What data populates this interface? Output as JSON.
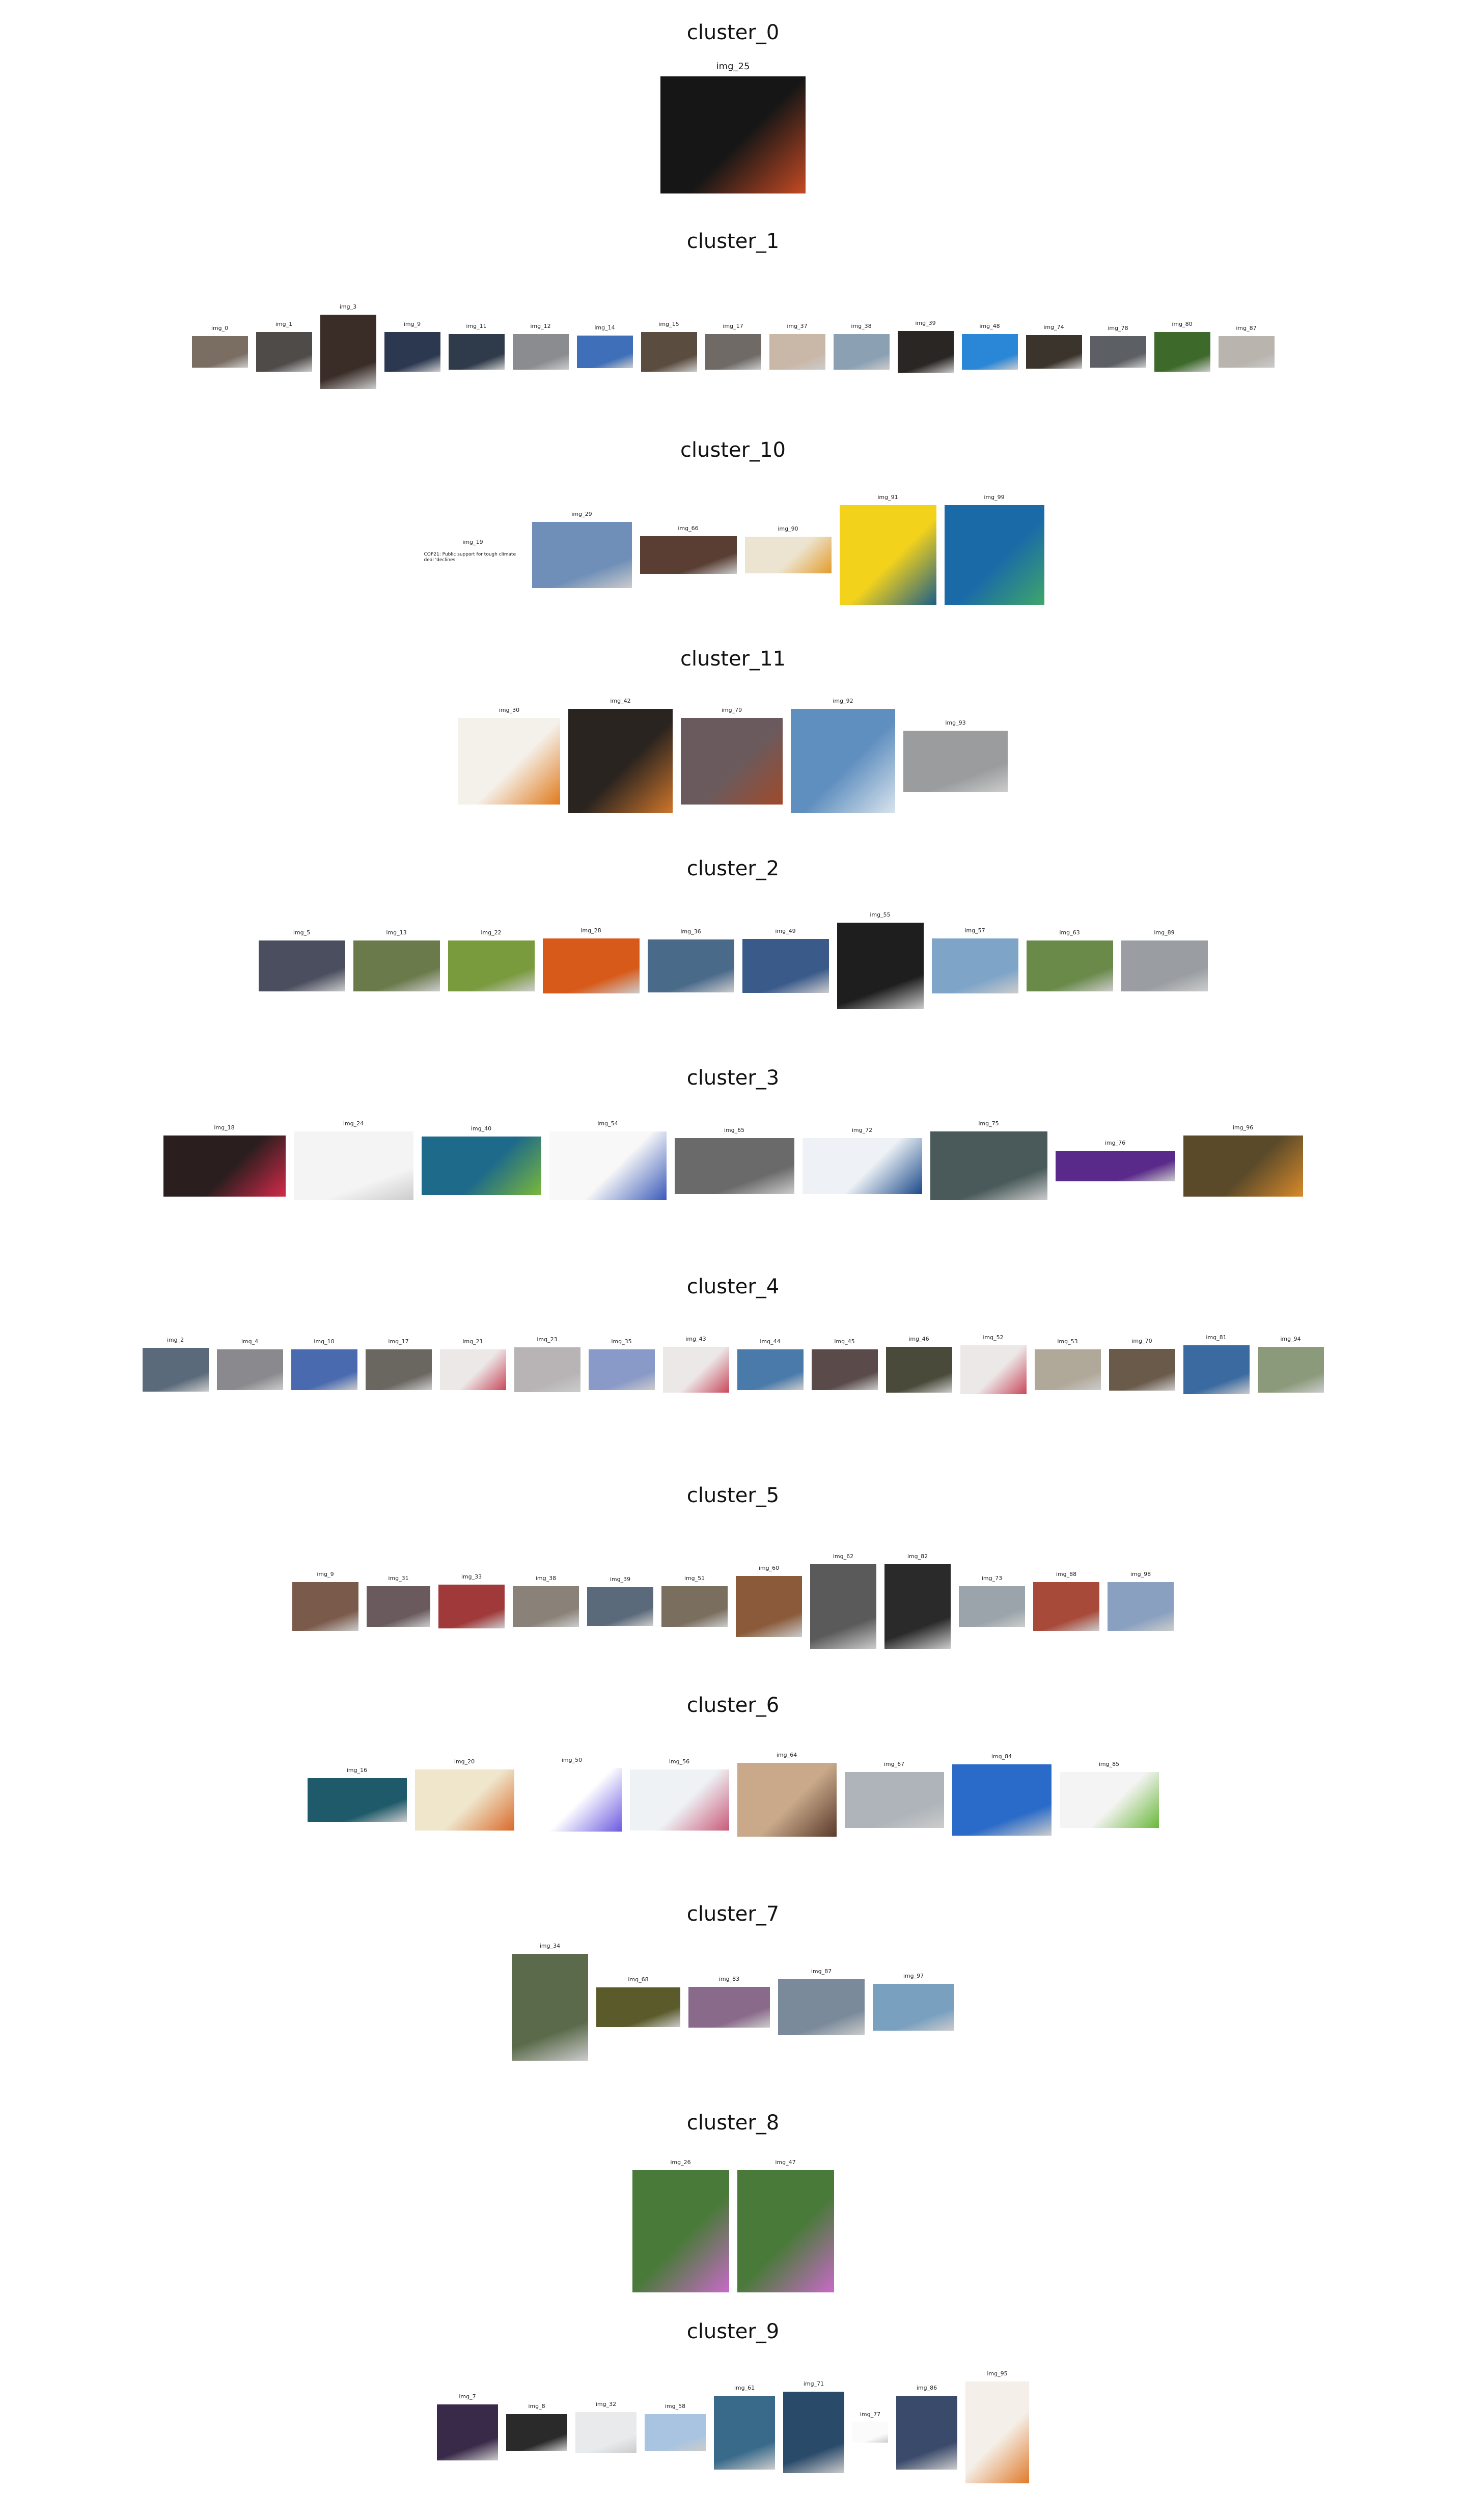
{
  "clusters": [
    {
      "title": "cluster_0",
      "images": [
        {
          "label": "img_25",
          "color": "#161616",
          "accent": "#c64a24"
        }
      ]
    },
    {
      "title": "cluster_1",
      "images": [
        {
          "label": "img_0",
          "color": "#7a6e62"
        },
        {
          "label": "img_1",
          "color": "#4e4b49"
        },
        {
          "label": "img_3",
          "color": "#3a2d28"
        },
        {
          "label": "img_9",
          "color": "#2b3850"
        },
        {
          "label": "img_11",
          "color": "#2f3a4a"
        },
        {
          "label": "img_12",
          "color": "#8a8c90"
        },
        {
          "label": "img_14",
          "color": "#3f6fb8"
        },
        {
          "label": "img_15",
          "color": "#5a4c3e"
        },
        {
          "label": "img_17",
          "color": "#6f6a66"
        },
        {
          "label": "img_37",
          "color": "#c9b8a8"
        },
        {
          "label": "img_38",
          "color": "#8ca0b4"
        },
        {
          "label": "img_39",
          "color": "#2a2624"
        },
        {
          "label": "img_48",
          "color": "#2a86d6"
        },
        {
          "label": "img_74",
          "color": "#3b342c"
        },
        {
          "label": "img_78",
          "color": "#5c6064"
        },
        {
          "label": "img_80",
          "color": "#3d6a2a"
        },
        {
          "label": "img_87",
          "color": "#b9b4ae"
        }
      ]
    },
    {
      "title": "cluster_10",
      "images": [
        {
          "label": "img_19",
          "color": "#ffffff",
          "text": "COP21: Public support for tough climate deal 'declines'"
        },
        {
          "label": "img_29",
          "color": "#6f8fb8"
        },
        {
          "label": "img_66",
          "color": "#5a3e34"
        },
        {
          "label": "img_90",
          "color": "#ece4d0",
          "accent": "#e39c2c"
        },
        {
          "label": "img_91",
          "color": "#f3d21c",
          "accent": "#1d5e86"
        },
        {
          "label": "img_99",
          "color": "#1a6aa8",
          "accent": "#3fa66a"
        }
      ]
    },
    {
      "title": "cluster_11",
      "images": [
        {
          "label": "img_30",
          "color": "#f4f0ea",
          "accent": "#e07a1a"
        },
        {
          "label": "img_42",
          "color": "#2a2420",
          "accent": "#d0762a"
        },
        {
          "label": "img_79",
          "color": "#6a5a5e",
          "accent": "#a04a2a"
        },
        {
          "label": "img_92",
          "color": "#5f8fbf",
          "accent": "#d9e4ee"
        },
        {
          "label": "img_93",
          "color": "#9a9c9e"
        }
      ]
    },
    {
      "title": "cluster_2",
      "images": [
        {
          "label": "img_5",
          "color": "#4a4e5e"
        },
        {
          "label": "img_13",
          "color": "#6a7a4a"
        },
        {
          "label": "img_22",
          "color": "#7a9a3e"
        },
        {
          "label": "img_28",
          "color": "#d85a1a"
        },
        {
          "label": "img_36",
          "color": "#4a6a8a"
        },
        {
          "label": "img_49",
          "color": "#3a5a8a"
        },
        {
          "label": "img_55",
          "color": "#1e1e1e"
        },
        {
          "label": "img_57",
          "color": "#7ea4c8"
        },
        {
          "label": "img_63",
          "color": "#6a8a4a"
        },
        {
          "label": "img_89",
          "color": "#9a9ea2"
        }
      ]
    },
    {
      "title": "cluster_3",
      "images": [
        {
          "label": "img_18",
          "color": "#2a1e1e",
          "accent": "#d42a4a"
        },
        {
          "label": "img_24",
          "color": "#f4f4f4"
        },
        {
          "label": "img_40",
          "color": "#1e6a8a",
          "accent": "#7ab83a"
        },
        {
          "label": "img_54",
          "color": "#f8f8f8",
          "accent": "#3a5ab8"
        },
        {
          "label": "img_65",
          "color": "#6a6a6a"
        },
        {
          "label": "img_72",
          "color": "#eef2f6",
          "accent": "#1a4a8a"
        },
        {
          "label": "img_75",
          "color": "#4a5a5a"
        },
        {
          "label": "img_76",
          "color": "#5a2a8a"
        },
        {
          "label": "img_96",
          "color": "#5a4a2a",
          "accent": "#d88a2a"
        }
      ]
    },
    {
      "title": "cluster_4",
      "images": [
        {
          "label": "img_2",
          "color": "#5a6a7a"
        },
        {
          "label": "img_4",
          "color": "#8a8a8e"
        },
        {
          "label": "img_10",
          "color": "#4a6ab0"
        },
        {
          "label": "img_17",
          "color": "#6a6660"
        },
        {
          "label": "img_21",
          "color": "#ece8e8",
          "accent": "#c8485a"
        },
        {
          "label": "img_23",
          "color": "#b8b4b6"
        },
        {
          "label": "img_35",
          "color": "#8a9ac8"
        },
        {
          "label": "img_43",
          "color": "#ece8e8",
          "accent": "#c8485a"
        },
        {
          "label": "img_44",
          "color": "#4a7aaa"
        },
        {
          "label": "img_45",
          "color": "#5a4a4a"
        },
        {
          "label": "img_46",
          "color": "#4a4a3a"
        },
        {
          "label": "img_52",
          "color": "#ece8e8",
          "accent": "#c8485a"
        },
        {
          "label": "img_53",
          "color": "#b0a898"
        },
        {
          "label": "img_70",
          "color": "#6a5a4a"
        },
        {
          "label": "img_81",
          "color": "#3a6aa0"
        },
        {
          "label": "img_94",
          "color": "#8a9a7a"
        }
      ]
    },
    {
      "title": "cluster_5",
      "images": [
        {
          "label": "img_9",
          "color": "#7a5a4a"
        },
        {
          "label": "img_31",
          "color": "#6a5a5e"
        },
        {
          "label": "img_33",
          "color": "#a03a3a"
        },
        {
          "label": "img_38",
          "color": "#8a8278"
        },
        {
          "label": "img_39",
          "color": "#5a6a7a"
        },
        {
          "label": "img_51",
          "color": "#7a6e5e"
        },
        {
          "label": "img_60",
          "color": "#8a5a3a"
        },
        {
          "label": "img_62",
          "color": "#5a5a5a"
        },
        {
          "label": "img_82",
          "color": "#2a2a2a"
        },
        {
          "label": "img_73",
          "color": "#9aa4aa"
        },
        {
          "label": "img_88",
          "color": "#a84a3a"
        },
        {
          "label": "img_98",
          "color": "#8aa0c0"
        }
      ]
    },
    {
      "title": "cluster_6",
      "images": [
        {
          "label": "img_16",
          "color": "#1e5a6a"
        },
        {
          "label": "img_20",
          "color": "#efe6cc",
          "accent": "#d86a2a"
        },
        {
          "label": "img_50",
          "color": "#ffffff",
          "accent": "#6a5ae0"
        },
        {
          "label": "img_56",
          "color": "#eef2f4",
          "accent": "#c85a7a"
        },
        {
          "label": "img_64",
          "color": "#c9a98a",
          "accent": "#5a3a2a"
        },
        {
          "label": "img_67",
          "color": "#aeb4ba"
        },
        {
          "label": "img_84",
          "color": "#2a6ac8"
        },
        {
          "label": "img_85",
          "color": "#f4f4f4",
          "accent": "#6ab83a"
        }
      ]
    },
    {
      "title": "cluster_7",
      "images": [
        {
          "label": "img_34",
          "color": "#5a6a4a"
        },
        {
          "label": "img_68",
          "color": "#5a5a2a"
        },
        {
          "label": "img_83",
          "color": "#8a6a8a"
        },
        {
          "label": "img_87",
          "color": "#7a8a9a"
        },
        {
          "label": "img_97",
          "color": "#7aa0c0"
        }
      ]
    },
    {
      "title": "cluster_8",
      "images": [
        {
          "label": "img_26",
          "color": "#4a7a3a",
          "accent": "#c86ac8"
        },
        {
          "label": "img_47",
          "color": "#4a7a3a",
          "accent": "#c86ac8"
        }
      ]
    },
    {
      "title": "cluster_9",
      "images": [
        {
          "label": "img_7",
          "color": "#3a2a4a"
        },
        {
          "label": "img_8",
          "color": "#2a2a2a"
        },
        {
          "label": "img_32",
          "color": "#e8eaec"
        },
        {
          "label": "img_58",
          "color": "#a8c4e0"
        },
        {
          "label": "img_61",
          "color": "#3a6a8a"
        },
        {
          "label": "img_71",
          "color": "#2a4a6a"
        },
        {
          "label": "img_77",
          "color": "#fbfbfb"
        },
        {
          "label": "img_86",
          "color": "#3a4a6a"
        },
        {
          "label": "img_95",
          "color": "#f4efe8",
          "accent": "#e07a2a"
        }
      ]
    }
  ]
}
